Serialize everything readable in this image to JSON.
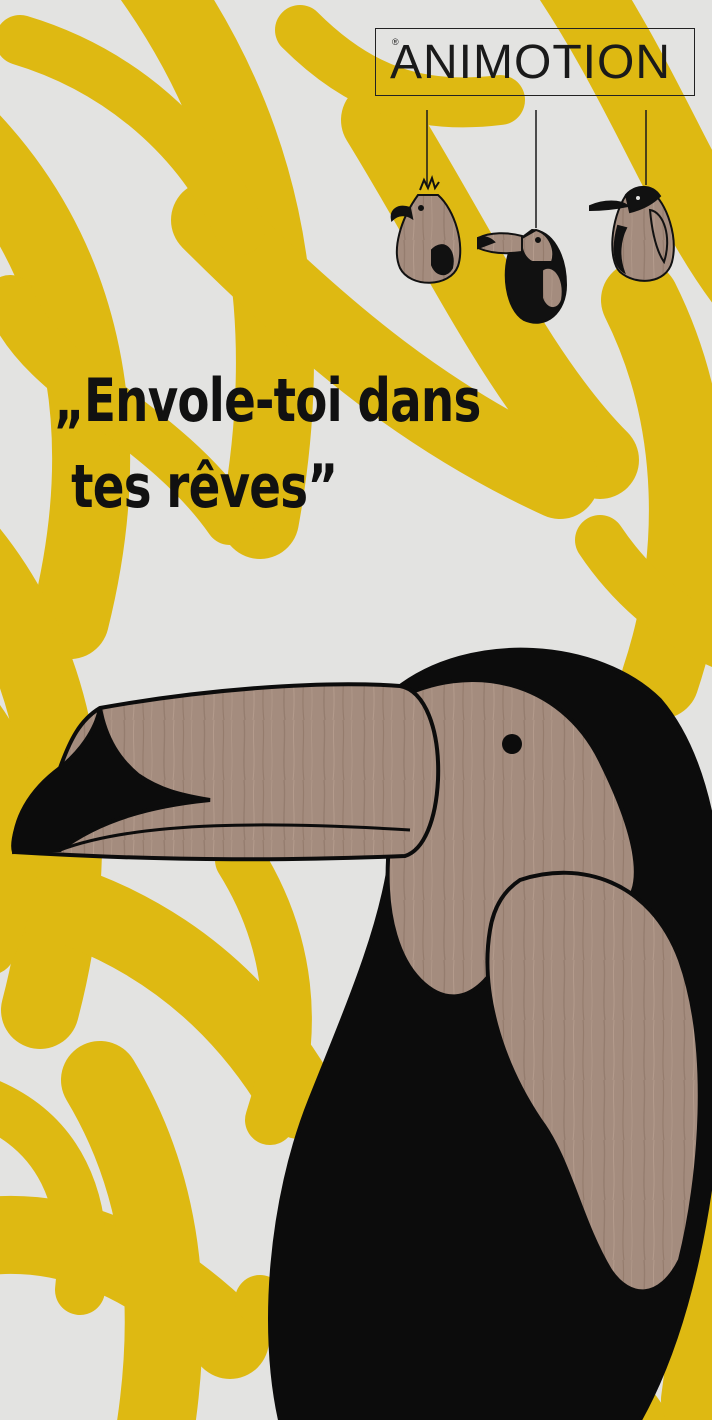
{
  "brand": {
    "registered_mark": "®",
    "name": "ANIMOTION"
  },
  "headline": {
    "line1": "„Envole-toi dans",
    "line2": "tes rêves”"
  },
  "colors": {
    "background": "#e3e3e1",
    "yellow": "#deb912",
    "black": "#0c0c0c",
    "wood": "#a48c7e"
  },
  "illustrations": [
    "parrot-ornament",
    "toucan-ornament",
    "penguin-ornament",
    "toucan"
  ]
}
